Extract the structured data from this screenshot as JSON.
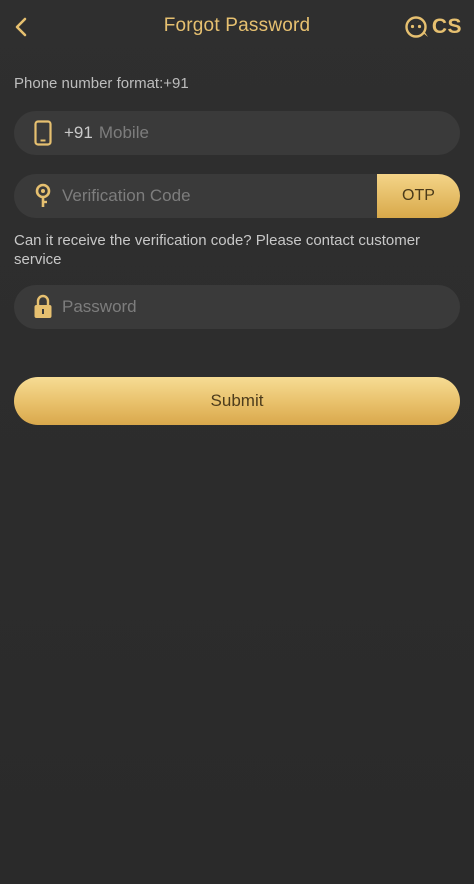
{
  "header": {
    "title": "Forgot Password",
    "cs_label": "CS"
  },
  "form": {
    "phone_format_label": "Phone number format:+91",
    "mobile": {
      "prefix": "+91",
      "placeholder": "Mobile",
      "value": ""
    },
    "verification": {
      "placeholder": "Verification Code",
      "value": "",
      "otp_label": "OTP"
    },
    "help_text": "Can it receive the verification code? Please contact customer service",
    "password": {
      "placeholder": "Password",
      "value": ""
    },
    "submit_label": "Submit"
  },
  "icons": {
    "back": "chevron-left-icon",
    "customer_service": "chat-face-icon",
    "mobile": "phone-icon",
    "verification": "key-icon",
    "password": "lock-icon"
  },
  "colors": {
    "background": "#2c2c2c",
    "accent": "#e6c070",
    "field_bg": "#3a3a3a",
    "button_gold_top": "#f6dc94",
    "button_gold_bottom": "#d9a84c"
  }
}
